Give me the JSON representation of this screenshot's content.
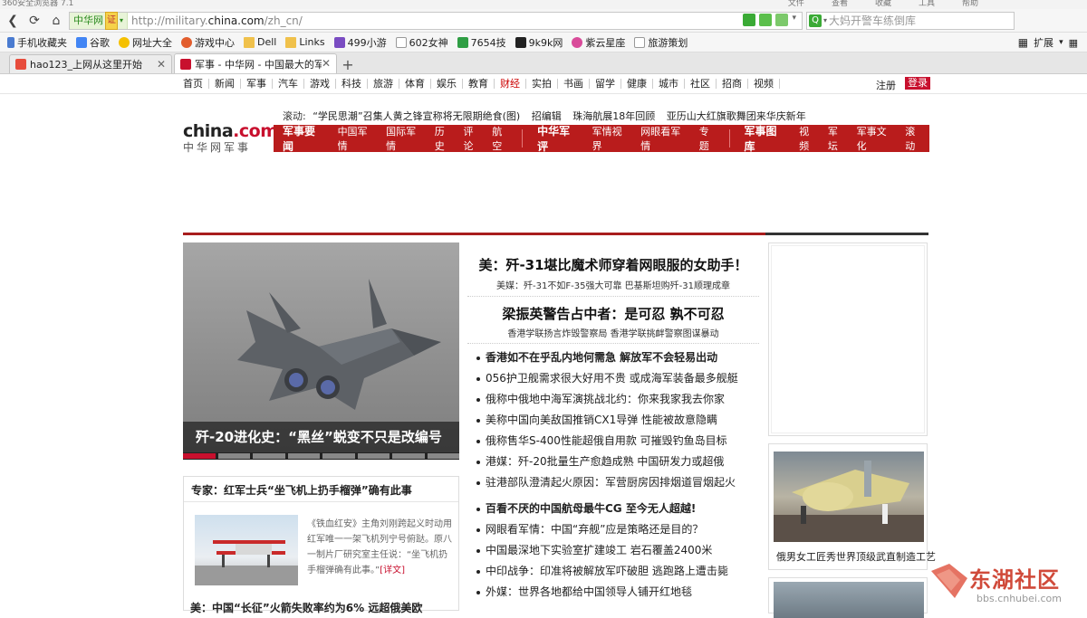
{
  "browser": {
    "title": "360安全浏览器 7.1",
    "title_menu": [
      "文件",
      "查看",
      "收藏",
      "工具",
      "帮助"
    ],
    "site_badge": "中华网",
    "cert_badge": "证",
    "url": "http://military.",
    "url_domain": "china.com",
    "url_path": "/zh_cn/",
    "search_placeholder": "大妈开警车练倒库",
    "search_icon": "Q",
    "bookmarks": [
      {
        "label": "手机收藏夹",
        "icon": "phone"
      },
      {
        "label": "谷歌",
        "icon": "google"
      },
      {
        "label": "网址大全",
        "icon": "360"
      },
      {
        "label": "游戏中心",
        "icon": "game"
      },
      {
        "label": "Dell",
        "icon": "folder"
      },
      {
        "label": "Links",
        "icon": "folder"
      },
      {
        "label": "499小游",
        "icon": "game2"
      },
      {
        "label": "602女神",
        "icon": "page"
      },
      {
        "label": "7654技",
        "icon": "tech"
      },
      {
        "label": "9k9k网",
        "icon": "9k"
      },
      {
        "label": "紫云星座",
        "icon": "star"
      },
      {
        "label": "旅游策划",
        "icon": "page"
      }
    ],
    "extensions_label": "扩展",
    "tabs": [
      {
        "label": "hao123_上网从这里开始",
        "active": false
      },
      {
        "label": "军事 - 中华网 - 中国最大的军",
        "active": true
      }
    ]
  },
  "topnav": {
    "items": [
      "首页",
      "新闻",
      "军事",
      "汽车",
      "游戏",
      "科技",
      "旅游",
      "体育",
      "娱乐",
      "教育",
      "财经",
      "实拍",
      "书画",
      "留学",
      "健康",
      "城市",
      "社区",
      "招商",
      "视频"
    ],
    "highlight": "财经",
    "login": "注册",
    "register": "登录"
  },
  "header": {
    "logo_main": "china",
    "logo_dotcom": ".com",
    "logo_sub": "中华网军事",
    "ticker_label": "滚动:",
    "ticker": [
      "“学民思潮”召集人黄之锋宣称将无限期绝食(图)",
      "招编辑",
      "珠海航展18年回顾",
      "亚历山大红旗歌舞团来华庆新年"
    ],
    "channels": [
      {
        "title": "军事要闻",
        "items": [
          "中国军情",
          "国际军情",
          "历史",
          "评论",
          "航空"
        ]
      },
      {
        "title": "中华军评",
        "items": [
          "军情视界",
          "网眼看军情",
          "专题"
        ]
      },
      {
        "title": "军事图库",
        "items": [
          "视频",
          "军坛",
          "军事文化",
          "滚动"
        ]
      }
    ]
  },
  "hero": {
    "caption": "歼-20进化史：“黑丝”蜕变不只是改编号",
    "slide_count": 8,
    "active_slide": 0
  },
  "expert": {
    "title": "专家：红军士兵“坐飞机上扔手榴弹”确有此事",
    "body": "《铁血红安》主角刘刚跨起义时动用红军唯一一架飞机列宁号俯跶。原八一制片厂研究室主任说：“坐飞机扔手榴弹确有此事。”",
    "more": "[详文]"
  },
  "bottom_lead": "美：中国“长征”火箭失败率约为6% 远超俄美欧",
  "news": {
    "headline1": "美：歼-31堪比魔术师穿着网眼服的女助手！",
    "sub1": "美媒：歼-31不如F-35强大可靠  巴基斯坦购歼-31顺理成章",
    "headline2": "梁振英警告占中者：是可忍 孰不可忍",
    "sub2": "香港学联扬言炸毁警察局  香港学联挑衅警察图谋暴动",
    "list1": [
      {
        "text": "香港如不在乎乱内地何需急 解放军不会轻易出动",
        "bold": true
      },
      {
        "text": "056护卫舰需求很大好用不贵 或成海军装备最多舰艇",
        "bold": false
      },
      {
        "text": "俄称中俄地中海军演挑战北约：你来我家我去你家",
        "bold": false
      },
      {
        "text": "美称中国向美敌国推销CX1导弹 性能被故意隐瞒",
        "bold": false
      },
      {
        "text": "俄称售华S-400性能超俄自用款 可摧毁钓鱼岛目标",
        "bold": false
      },
      {
        "text": "港媒：歼-20批量生产愈趋成熟 中国研发力或超俄",
        "bold": false
      },
      {
        "text": "驻港部队澄清起火原因：军营厨房因排烟道冒烟起火",
        "bold": false
      }
    ],
    "list2": [
      {
        "text": "百看不厌的中国航母最牛CG 至今无人超越!",
        "bold": true
      },
      {
        "text": "网眼看军情：中国“弃舰”应是策略还是目的？",
        "bold": false
      },
      {
        "text": "中国最深地下实验室扩建竣工 岩石覆盖2400米",
        "bold": false
      },
      {
        "text": "中印战争：印准将被解放军吓破胆 逃跑路上遭击毙",
        "bold": false
      },
      {
        "text": "外媒：世界各地都给中国领导人铺开红地毯",
        "bold": false
      }
    ]
  },
  "photo": {
    "caption": "俄男女工匠秀世界顶级武直制造工艺"
  },
  "watermark": {
    "text": "东湖社区",
    "url": "bbs.cnhubei.com"
  },
  "colors": {
    "brand_red": "#b91c1c",
    "accent_red": "#c8102e",
    "topline_dark": "#333333"
  }
}
